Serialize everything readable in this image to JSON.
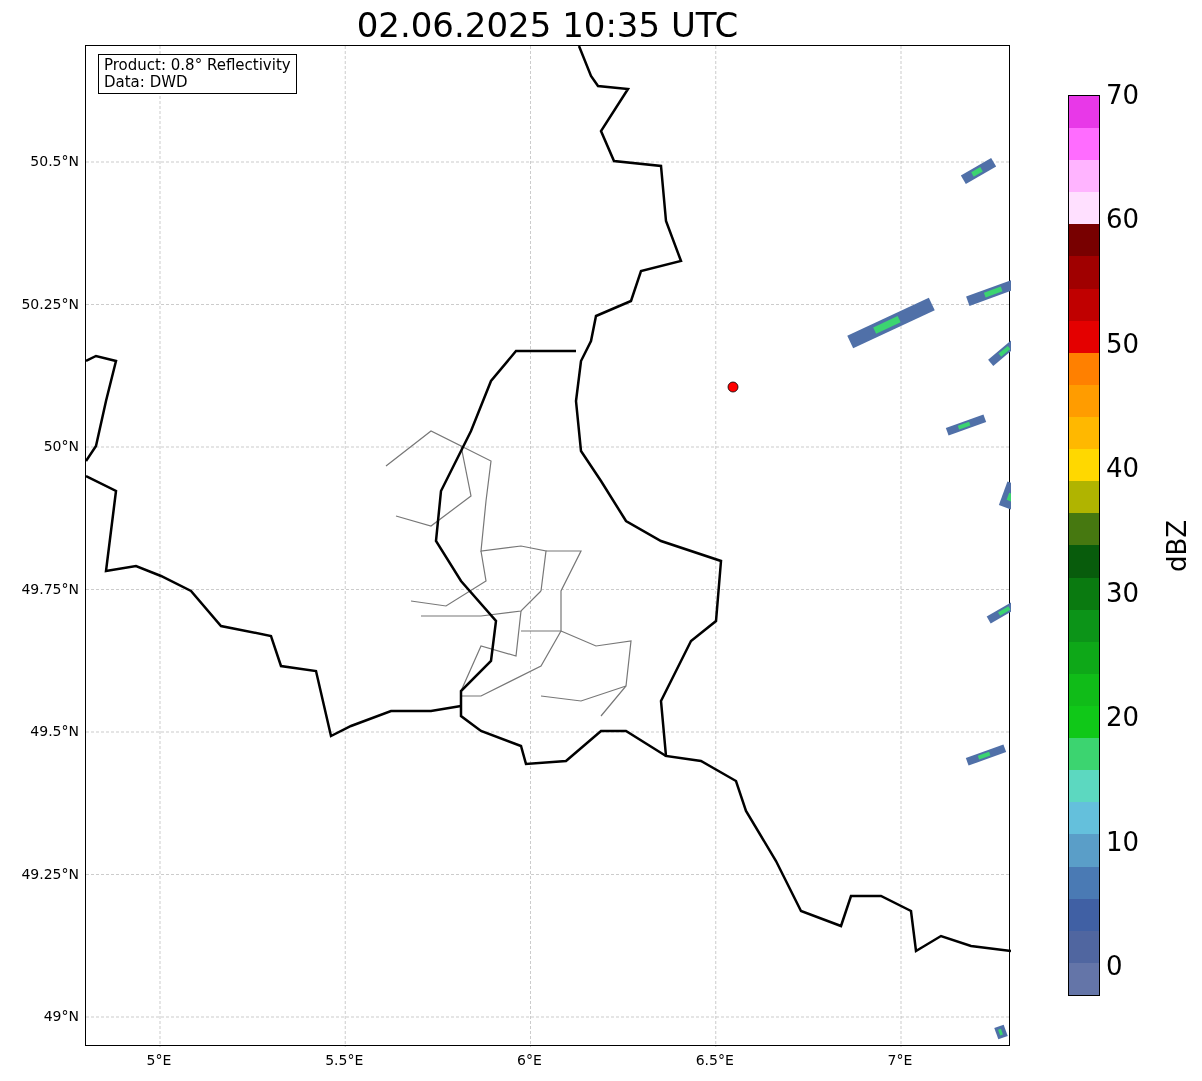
{
  "title": "02.06.2025 10:35 UTC",
  "info_box": [
    "Product: 0.8° Reflectivity",
    "Data: DWD"
  ],
  "map": {
    "lat_labels": [
      "50.5°N",
      "50.25°N",
      "50°N",
      "49.75°N",
      "49.5°N",
      "49.25°N",
      "49°N"
    ],
    "lon_labels": [
      "5°E",
      "5.5°E",
      "6°E",
      "6.5°E",
      "7°E"
    ]
  },
  "colorbar": {
    "label": "dBZ",
    "ticks": [
      "70",
      "60",
      "50",
      "40",
      "30",
      "20",
      "10",
      "0"
    ],
    "bins": [
      {
        "color": "#6475a8"
      },
      {
        "color": "#5066a0"
      },
      {
        "color": "#4060a4"
      },
      {
        "color": "#4a7ab4"
      },
      {
        "color": "#5a9ec8"
      },
      {
        "color": "#64c0dc"
      },
      {
        "color": "#5cd8c0"
      },
      {
        "color": "#3cd470"
      },
      {
        "color": "#10c818"
      },
      {
        "color": "#10bc18"
      },
      {
        "color": "#0ea818"
      },
      {
        "color": "#0c9418"
      },
      {
        "color": "#0a7a10"
      },
      {
        "color": "#085c0c"
      },
      {
        "color": "#467810"
      },
      {
        "color": "#b0b400"
      },
      {
        "color": "#ffd800"
      },
      {
        "color": "#ffb800"
      },
      {
        "color": "#ff9c00"
      },
      {
        "color": "#ff8000"
      },
      {
        "color": "#e40000"
      },
      {
        "color": "#c00000"
      },
      {
        "color": "#a00000"
      },
      {
        "color": "#780000"
      },
      {
        "color": "#ffe0ff"
      },
      {
        "color": "#ffb4ff"
      },
      {
        "color": "#ff6cff"
      },
      {
        "color": "#e838e8"
      }
    ]
  }
}
